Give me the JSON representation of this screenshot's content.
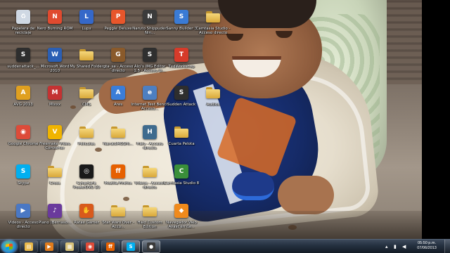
{
  "desktop": {
    "icons": [
      {
        "label": "Papelera de reciclaje",
        "glyph": "recycle-bin-icon",
        "color": "#cfd8e3",
        "sym": "♻"
      },
      {
        "label": "Nero Burning ROM",
        "glyph": "nero-icon",
        "color": "#e04a2f",
        "sym": "N"
      },
      {
        "label": "Lupx",
        "glyph": "lupx-icon",
        "color": "#3568c9",
        "sym": "L"
      },
      {
        "label": "Peggle Deluxe",
        "glyph": "peggle-icon",
        "color": "#e8562b",
        "sym": "P"
      },
      {
        "label": "Naruto Shippuden Nin...",
        "glyph": "naruto-icon",
        "color": "#3b3b3b",
        "sym": "N"
      },
      {
        "label": "Sanny Builder 3",
        "glyph": "sanny-builder-icon",
        "color": "#3a7bd5",
        "sym": "S"
      },
      {
        "label": "Camtasia Studio - Acceso directo",
        "glyph": "folder-icon",
        "color": "",
        "sym": ""
      },
      {
        "label": "suddenattack_...",
        "glyph": "sudden-attack-icon",
        "color": "#2e2e2e",
        "sym": "S"
      },
      {
        "label": "Microsoft Word 2010",
        "glyph": "word-icon",
        "color": "#2b5fb4",
        "sym": "W"
      },
      {
        "label": "My Shared Folder",
        "glyph": "folder-icon",
        "color": "",
        "sym": ""
      },
      {
        "label": "gta_sa - Acceso directo",
        "glyph": "gta-icon",
        "color": "#8a5a2b",
        "sym": "G"
      },
      {
        "label": "Alci's IMG Editor 1.5 - Acceso di...",
        "glyph": "img-editor-icon",
        "color": "#2f2f2f",
        "sym": "S"
      },
      {
        "label": "TxdWorkshop",
        "glyph": "txd-workshop-icon",
        "color": "#d63b2a",
        "sym": "T"
      },
      {
        "label": "AVG 2013",
        "glyph": "avg-icon",
        "color": "#e0a020",
        "sym": "A"
      },
      {
        "label": "Mixxx",
        "glyph": "mixxx-icon",
        "color": "#c43232",
        "sym": "M"
      },
      {
        "label": "CMS",
        "glyph": "folder-icon",
        "color": "",
        "sym": ""
      },
      {
        "label": "Ares",
        "glyph": "ares-icon",
        "color": "#3b7dd8",
        "sym": "A"
      },
      {
        "label": "Internet Test Bench Acceso...",
        "glyph": "internet-bench-icon",
        "color": "#4d7fc1",
        "sym": "e"
      },
      {
        "label": "Sudden Attack",
        "glyph": "sudden-attack-icon",
        "color": "#2e2e2e",
        "sym": "S"
      },
      {
        "label": "Audios",
        "glyph": "folder-icon",
        "color": "",
        "sym": ""
      },
      {
        "label": "Google Chrome",
        "glyph": "chrome-icon",
        "color": "#dd4b39",
        "sym": "◉"
      },
      {
        "label": "Freemake Video Converter",
        "glyph": "freemake-icon",
        "color": "#f0b400",
        "sym": "V"
      },
      {
        "label": "Peliculas",
        "glyph": "folder-icon",
        "color": "",
        "sym": ""
      },
      {
        "label": "NarutoMOSHI...",
        "glyph": "folder-icon",
        "color": "",
        "sym": ""
      },
      {
        "label": "Halo - Acceso directo",
        "glyph": "halo-icon",
        "color": "#3f6b8e",
        "sym": "H"
      },
      {
        "label": "Cuarta Pelota",
        "glyph": "folder-icon",
        "color": "",
        "sym": ""
      },
      {
        "label": "Skype",
        "glyph": "skype-icon",
        "color": "#00aff0",
        "sym": "S"
      },
      {
        "label": "Cross",
        "glyph": "folder-icon",
        "color": "",
        "sym": ""
      },
      {
        "label": "CyberLink PowerDVD 10",
        "glyph": "powerdvd-icon",
        "color": "#1a1a1a",
        "sym": "◎"
      },
      {
        "label": "Mozilla Firefox",
        "glyph": "firefox-icon",
        "color": "#e66000",
        "sym": "ff"
      },
      {
        "label": "Videos - Acceso directo",
        "glyph": "folder-icon",
        "color": "",
        "sym": ""
      },
      {
        "label": "Camtasia Studio 8",
        "glyph": "camtasia-icon",
        "color": "#3a8f3a",
        "sym": "C"
      },
      {
        "label": "Videos - Acceso directo",
        "glyph": "videos-shortcut-icon",
        "color": "#4a78c4",
        "sym": "▶"
      },
      {
        "label": "Piano (Bernaso...",
        "glyph": "piano-icon",
        "color": "#6a3a9c",
        "sym": "♪"
      },
      {
        "label": "Ratas Gamer",
        "glyph": "ratas-icon",
        "color": "#d85a1c",
        "sym": "✋"
      },
      {
        "label": "Star Wars Over - Acco...",
        "glyph": "folder-icon",
        "color": "",
        "sym": ""
      },
      {
        "label": "Halo Custom Edition",
        "glyph": "folder-icon",
        "color": "",
        "sym": ""
      },
      {
        "label": "Navegador Web Avast en ca...",
        "glyph": "avast-browser-icon",
        "color": "#f08a1c",
        "sym": "◆"
      }
    ]
  },
  "taskbar": {
    "pinned": [
      {
        "name": "explorer-taskbar-item",
        "icon": "explorer-icon",
        "color": "#e8b84a",
        "sym": "▤",
        "active": false
      },
      {
        "name": "media-player-taskbar-item",
        "icon": "media-player-icon",
        "color": "#e07b1c",
        "sym": "▶",
        "active": false
      },
      {
        "name": "library-taskbar-item",
        "icon": "library-icon",
        "color": "#d8c27a",
        "sym": "▦",
        "active": false
      },
      {
        "name": "chrome-taskbar-item",
        "icon": "chrome-icon",
        "color": "#dd4b39",
        "sym": "◉",
        "active": false
      },
      {
        "name": "firefox-taskbar-item",
        "icon": "firefox-icon",
        "color": "#e66000",
        "sym": "ff",
        "active": false
      },
      {
        "name": "skype-taskbar-item",
        "icon": "skype-icon",
        "color": "#00aff0",
        "sym": "S",
        "active": true
      },
      {
        "name": "camtasia-taskbar-item",
        "icon": "camtasia-recorder-icon",
        "color": "#3a3a3a",
        "sym": "●",
        "active": true
      }
    ],
    "tray": [
      {
        "icon": "up-arrow-icon",
        "sym": "▴"
      },
      {
        "icon": "network-icon",
        "sym": "▮"
      },
      {
        "icon": "volume-icon",
        "sym": "◀"
      }
    ],
    "clock": {
      "time": "05:50 p.m.",
      "date": "07/06/2013"
    }
  }
}
